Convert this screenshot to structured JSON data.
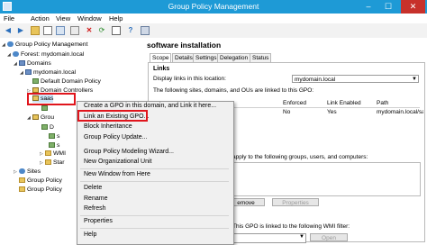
{
  "window": {
    "title": "Group Policy Management",
    "minimize": "–",
    "maximize": "☐",
    "close": "✕"
  },
  "menu": [
    "File",
    "Action",
    "View",
    "Window",
    "Help"
  ],
  "toolbar": [
    "back-icon",
    "forward-icon",
    "folder-icon",
    "properties-icon",
    "delete-icon",
    "refresh-icon",
    "export-icon",
    "help-icon",
    "console-icon"
  ],
  "tree": {
    "root": "Group Policy Management",
    "forest": "Forest: mydomain.local",
    "domains": "Domains",
    "domain": "mydomain.local",
    "default_policy": "Default Domain Policy",
    "domain_controllers": "Domain Controllers",
    "saasou": "saas",
    "grou1": "Grou",
    "item_d": "D",
    "item_s1": "s",
    "item_s2": "s",
    "wmi": "WMI",
    "starter": "Star",
    "sites": "Sites",
    "modeling": "Group Policy",
    "results": "Group Policy"
  },
  "right": {
    "title": "software installation",
    "tabs": [
      "Scope",
      "Details",
      "Settings",
      "Delegation",
      "Status"
    ],
    "links_header": "Links",
    "display_links_label": "Display links in this location:",
    "display_links_value": "mydomain.local",
    "links_desc": "The following sites, domains, and OUs are linked to this GPO:",
    "columns": [
      "Enforced",
      "Link Enabled",
      "Path"
    ],
    "row": {
      "enforced": "No",
      "link_enabled": "Yes",
      "path": "mydomain.local/saasps"
    },
    "filtering_desc": "apply to the following groups, users, and computers:",
    "remove_btn": "emove",
    "properties_btn": "Properties",
    "wmi_label": "This GPO is linked to the following WMI filter:",
    "open_btn": "Open"
  },
  "context_menu": {
    "items": [
      "Create a GPO in this domain, and Link it here...",
      "Link an Existing GPO...",
      "Block Inheritance",
      "Group Policy Update...",
      "Group Policy Modeling Wizard...",
      "New Organizational Unit",
      "New Window from Here",
      "Delete",
      "Rename",
      "Refresh",
      "Properties",
      "Help"
    ]
  },
  "colors": {
    "titlebar": "#1e9ad6",
    "highlight": "#e0151c",
    "close": "#c7312b"
  }
}
